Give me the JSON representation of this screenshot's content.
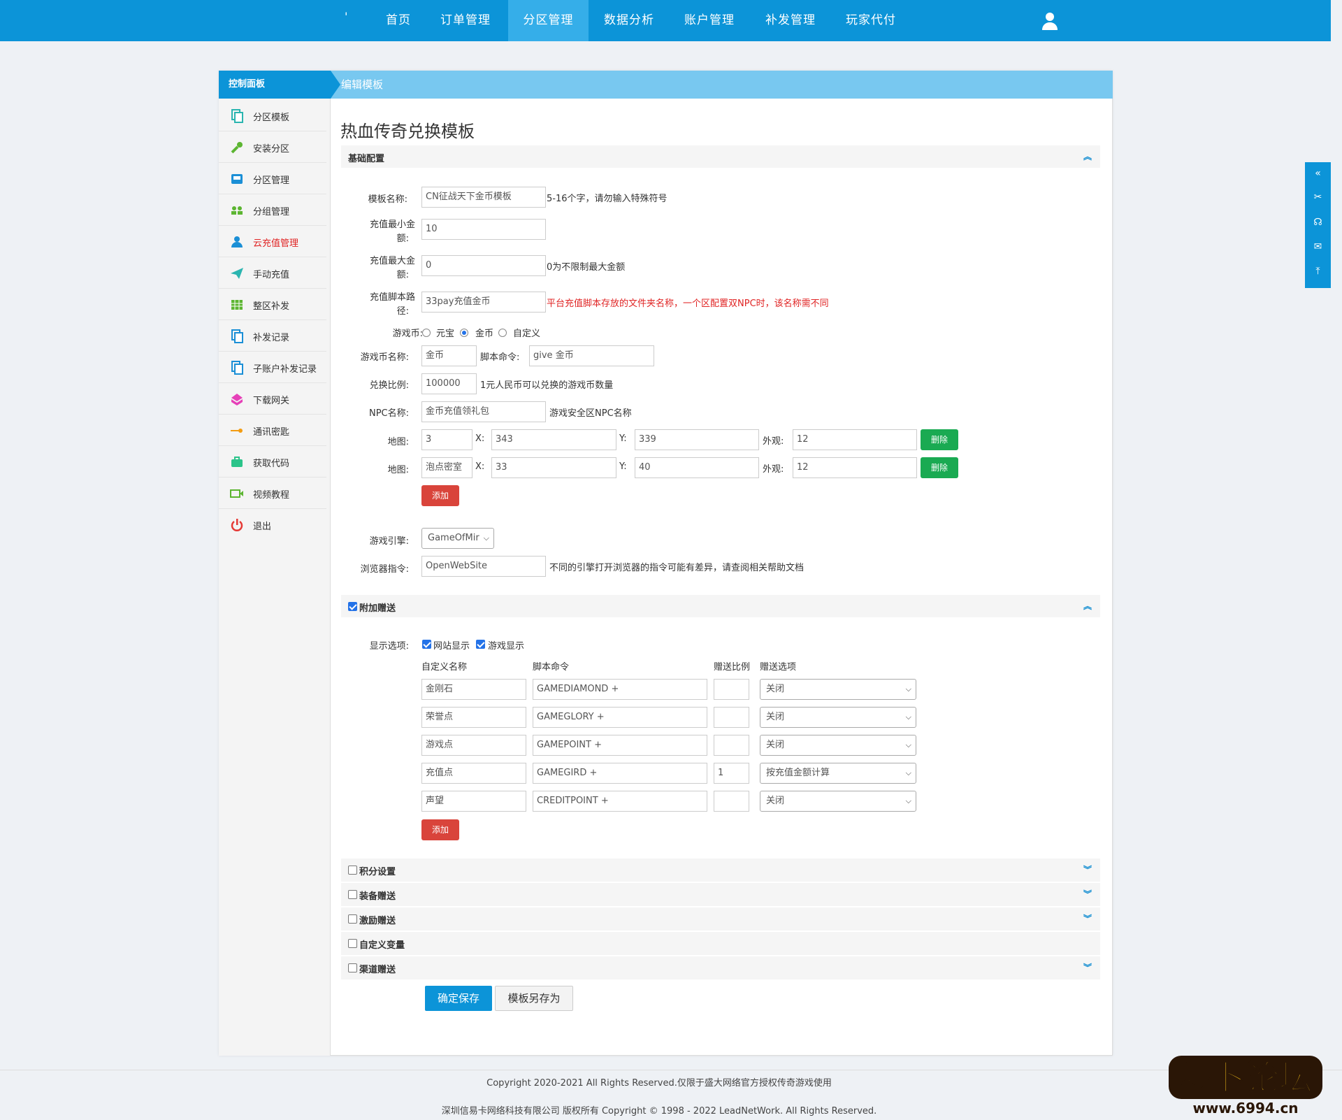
{
  "topnav": {
    "logo": "'",
    "items": [
      "首页",
      "订单管理",
      "分区管理",
      "数据分析",
      "账户管理",
      "补发管理",
      "玩家代付"
    ],
    "active": "分区管理"
  },
  "sidebar": {
    "title": "控制面板",
    "items": [
      {
        "label": "分区模板",
        "icon": "copy-icon"
      },
      {
        "label": "安装分区",
        "icon": "wrench-icon"
      },
      {
        "label": "分区管理",
        "icon": "inbox-icon"
      },
      {
        "label": "分组管理",
        "icon": "group-icon"
      },
      {
        "label": "云充值管理",
        "icon": "user-icon",
        "active": true
      },
      {
        "label": "手动充值",
        "icon": "paper-plane-icon"
      },
      {
        "label": "整区补发",
        "icon": "calendar-icon"
      },
      {
        "label": "补发记录",
        "icon": "copy-icon"
      },
      {
        "label": "子账户补发记录",
        "icon": "copy-icon"
      },
      {
        "label": "下载网关",
        "icon": "download-box-icon"
      },
      {
        "label": "通讯密匙",
        "icon": "key-icon"
      },
      {
        "label": "获取代码",
        "icon": "briefcase-icon"
      },
      {
        "label": "视频教程",
        "icon": "video-icon"
      },
      {
        "label": "退出",
        "icon": "power-icon"
      }
    ]
  },
  "main": {
    "header": "编辑模板",
    "title": "热血传奇兑换模板",
    "basic": {
      "section_title": "基础配置",
      "template_name": {
        "label": "模板名称:",
        "value": "CN征战天下金币模板",
        "hint": "5-16个字，请勿输入特殊符号"
      },
      "min_amount": {
        "label1": "充值最小金",
        "label2": "额:",
        "value": "10"
      },
      "max_amount": {
        "label1": "充值最大金",
        "label2": "额:",
        "value": "0",
        "hint": "0为不限制最大金额"
      },
      "script_path": {
        "label1": "充值脚本路",
        "label2": "径:",
        "value": "33pay充值金币",
        "hint": "平台充值脚本存放的文件夹名称，一个区配置双NPC时，该名称需不同"
      },
      "currency": {
        "label": "游戏币:",
        "options": [
          "元宝",
          "金币",
          "自定义"
        ],
        "selected": "金币"
      },
      "currency_name": {
        "label": "游戏币名称:",
        "value": "金币",
        "cmd_label": "脚本命令:",
        "cmd_value": "give 金币"
      },
      "ratio": {
        "label": "兑换比例:",
        "value": "100000",
        "hint": "1元人民币可以兑换的游戏币数量"
      },
      "npc": {
        "label": "NPC名称:",
        "value": "金币充值领礼包",
        "hint": "游戏安全区NPC名称"
      },
      "maps": [
        {
          "label": "地图:",
          "map": "3",
          "x_label": "X:",
          "x": "343",
          "y_label": "Y:",
          "y": "339",
          "look_label": "外观:",
          "look": "12",
          "delete": "删除"
        },
        {
          "label": "地图:",
          "map": "泡点密室",
          "x_label": "X:",
          "x": "33",
          "y_label": "Y:",
          "y": "40",
          "look_label": "外观:",
          "look": "12",
          "delete": "删除"
        }
      ],
      "add_button": "添加",
      "engine": {
        "label": "游戏引擎:",
        "value": "GameOfMir"
      },
      "browser": {
        "label": "浏览器指令:",
        "value": "OpenWebSite",
        "hint": "不同的引擎打开浏览器的指令可能有差异，请查阅相关帮助文档"
      }
    },
    "bonus": {
      "section_title": "附加赠送",
      "display_label": "显示选项:",
      "web_show": "网站显示",
      "game_show": "游戏显示",
      "columns": [
        "自定义名称",
        "脚本命令",
        "赠送比例",
        "赠送选项"
      ],
      "rows": [
        {
          "name": "金刚石",
          "cmd": "GAMEDIAMOND +",
          "ratio": "",
          "option": "关闭"
        },
        {
          "name": "荣誉点",
          "cmd": "GAMEGLORY +",
          "ratio": "",
          "option": "关闭"
        },
        {
          "name": "游戏点",
          "cmd": "GAMEPOINT +",
          "ratio": "",
          "option": "关闭"
        },
        {
          "name": "充值点",
          "cmd": "GAMEGIRD +",
          "ratio": "1",
          "option": "按充值金额计算"
        },
        {
          "name": "声望",
          "cmd": "CREDITPOINT +",
          "ratio": "",
          "option": "关闭"
        }
      ],
      "add_button": "添加"
    },
    "collapsed_sections": [
      "积分设置",
      "装备赠送",
      "激励赠送",
      "自定义变量",
      "渠道赠送"
    ],
    "save_button": "确定保存",
    "save_as_button": "模板另存为"
  },
  "footer": {
    "line1": "Copyright 2020-2021 All Rights Reserved.仅限于盛大网络官方授权传奇游戏使用",
    "line2": "深圳信易卡网络科技有限公司 版权所有 Copyright © 1998 - 2022 LeadNetWork. All Rights Reserved."
  },
  "watermark": {
    "text": "萝卜论坛",
    "url": "www.6994.cn"
  },
  "colors": {
    "primary": "#0c94d8",
    "header_light": "#78c8f0",
    "danger": "#d9443b",
    "success": "#1aaa52",
    "active_text": "#e02424"
  }
}
